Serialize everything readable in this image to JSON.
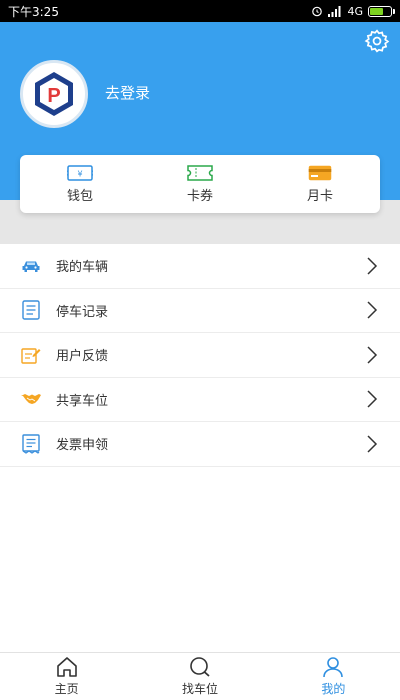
{
  "status_bar": {
    "time": "下午3:25",
    "network": "4G"
  },
  "header": {
    "login_text": "去登录",
    "logo_letter": "P"
  },
  "wallet": {
    "items": [
      {
        "label": "钱包",
        "icon": "wallet-icon",
        "glyph": "¥"
      },
      {
        "label": "卡券",
        "icon": "coupon-icon"
      },
      {
        "label": "月卡",
        "icon": "card-icon"
      }
    ]
  },
  "menu": {
    "items": [
      {
        "label": "我的车辆",
        "icon": "car-icon"
      },
      {
        "label": "停车记录",
        "icon": "record-icon"
      },
      {
        "label": "用户反馈",
        "icon": "feedback-icon"
      },
      {
        "label": "共享车位",
        "icon": "handshake-icon"
      },
      {
        "label": "发票申领",
        "icon": "invoice-icon"
      }
    ]
  },
  "tabbar": {
    "items": [
      {
        "label": "主页",
        "icon": "home-icon"
      },
      {
        "label": "找车位",
        "icon": "search-icon"
      },
      {
        "label": "我的",
        "icon": "user-icon"
      }
    ],
    "active": "我的"
  },
  "colors": {
    "primary": "#38a0ee",
    "active_tab": "#2f8fe0",
    "accent_orange": "#f5a623",
    "accent_green": "#2aa84a"
  }
}
